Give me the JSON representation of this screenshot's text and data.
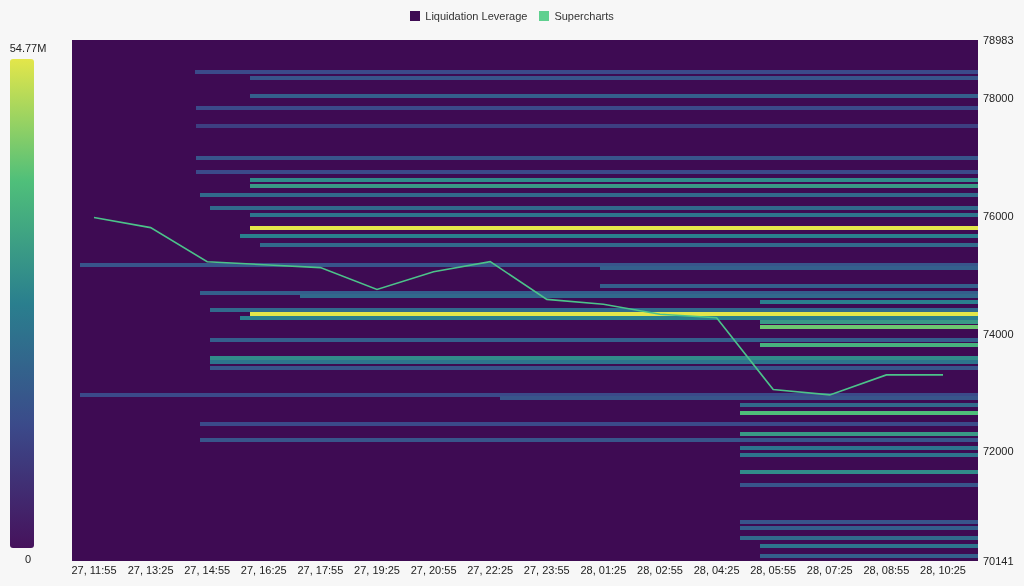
{
  "legend": [
    {
      "label": "Liquidation Leverage",
      "color": "#3e0b53"
    },
    {
      "label": "Supercharts",
      "color": "#5fd08f"
    }
  ],
  "color_scale": {
    "max_label": "54.77M",
    "min_label": "0"
  },
  "chart_data": {
    "type": "line",
    "categories": [
      "27, 11:55",
      "27, 13:25",
      "27, 14:55",
      "27, 16:25",
      "27, 17:55",
      "27, 19:25",
      "27, 20:55",
      "27, 22:25",
      "27, 23:55",
      "28, 01:25",
      "28, 02:55",
      "28, 04:25",
      "28, 05:55",
      "28, 07:25",
      "28, 08:55",
      "28, 10:25"
    ],
    "series": [
      {
        "color": "#4cc38a",
        "values": [
          75970,
          75800,
          75220,
          75170,
          75120,
          74750,
          75050,
          75220,
          74580,
          74500,
          74330,
          74270,
          73050,
          72960,
          73300,
          73300
        ]
      }
    ],
    "ylim": [
      70141,
      78983
    ],
    "yticks": [
      70141,
      72000,
      74000,
      76000,
      78000,
      78983
    ]
  }
}
